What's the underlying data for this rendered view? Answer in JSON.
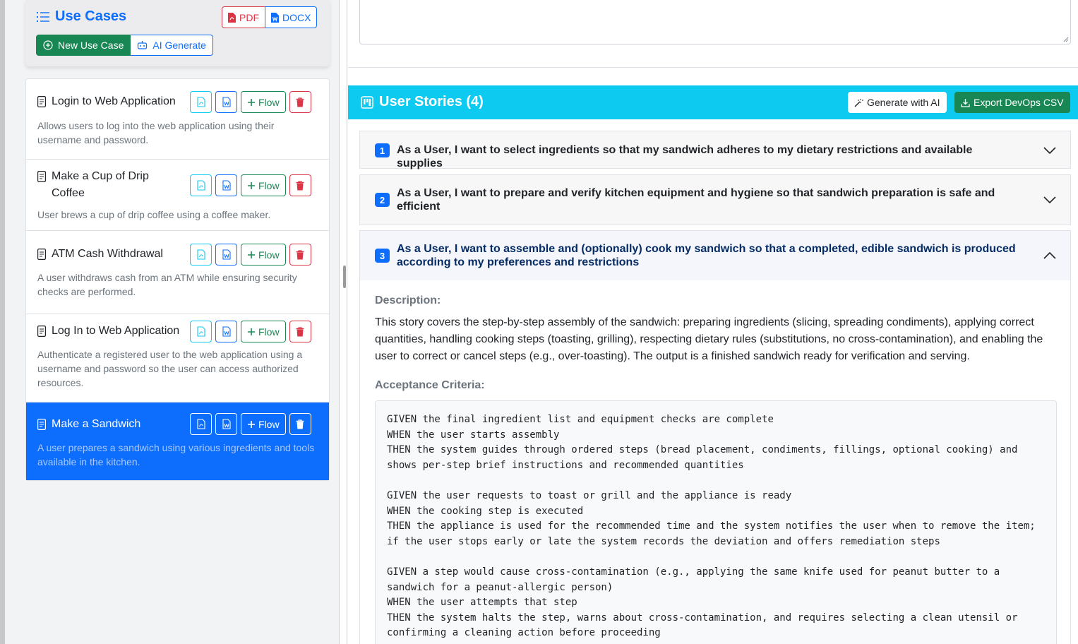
{
  "sidebar": {
    "title": "Use Cases",
    "export_pdf": "PDF",
    "export_docx": "DOCX",
    "new_use_case": "New Use Case",
    "ai_generate": "AI Generate",
    "flow_label": "Flow",
    "items": [
      {
        "name": "Login to Web Application",
        "description": "Allows users to log into the web application using their username and password.",
        "active": false
      },
      {
        "name": "Make a Cup of Drip Coffee",
        "description": "User brews a cup of drip coffee using a coffee maker.",
        "active": false
      },
      {
        "name": "ATM Cash Withdrawal",
        "description": "A user withdraws cash from an ATM while ensuring security checks are performed.",
        "active": false
      },
      {
        "name": "Log In to Web Application",
        "description": "Authenticate a registered user to the web application using a username and password so the user can access authorized resources.",
        "active": false
      },
      {
        "name": "Make a Sandwich",
        "description": "A user prepares a sandwich using various ingredients and tools available in the kitchen.",
        "active": true
      }
    ]
  },
  "user_stories": {
    "title": "User Stories (4)",
    "generate_button": "Generate with AI",
    "export_button": "Export DevOps CSV",
    "stories": [
      {
        "number": "1",
        "text": "As a User, I want to select ingredients so that my sandwich adheres to my dietary restrictions and available supplies",
        "expanded": false
      },
      {
        "number": "2",
        "text": "As a User, I want to prepare and verify kitchen equipment and hygiene so that sandwich preparation is safe and efficient",
        "expanded": false
      },
      {
        "number": "3",
        "text": "As a User, I want to assemble and (optionally) cook my sandwich so that a completed, edible sandwich is produced according to my preferences and restrictions",
        "expanded": true
      }
    ],
    "detail": {
      "description_label": "Description:",
      "description": "This story covers the step-by-step assembly of the sandwich: preparing ingredients (slicing, spreading condiments), applying correct quantities, handling cooking steps (toasting, grilling), respecting dietary rules (substitutions, no cross-contamination), and enabling the user to correct or cancel steps (e.g., over-toasting). The output is a finished sandwich ready for verification and serving.",
      "criteria_label": "Acceptance Criteria:",
      "criteria": "GIVEN the final ingredient list and equipment checks are complete\nWHEN the user starts assembly\nTHEN the system guides through ordered steps (bread placement, condiments, fillings, optional cooking) and shows per-step brief instructions and recommended quantities\n\nGIVEN the user requests to toast or grill and the appliance is ready\nWHEN the cooking step is executed\nTHEN the appliance is used for the recommended time and the system notifies the user when to remove the item; if the user stops early or late the system records the deviation and offers remediation steps\n\nGIVEN a step would cause cross-contamination (e.g., applying the same knife used for peanut butter to a sandwich for a peanut-allergic person)\nWHEN the user attempts that step\nTHEN the system halts the step, warns about cross-contamination, and requires selecting a clean utensil or confirming a cleaning action before proceeding"
    }
  },
  "colors": {
    "primary": "#0d6efd",
    "success": "#198754",
    "danger": "#dc3545",
    "info": "#0dcaf0"
  }
}
